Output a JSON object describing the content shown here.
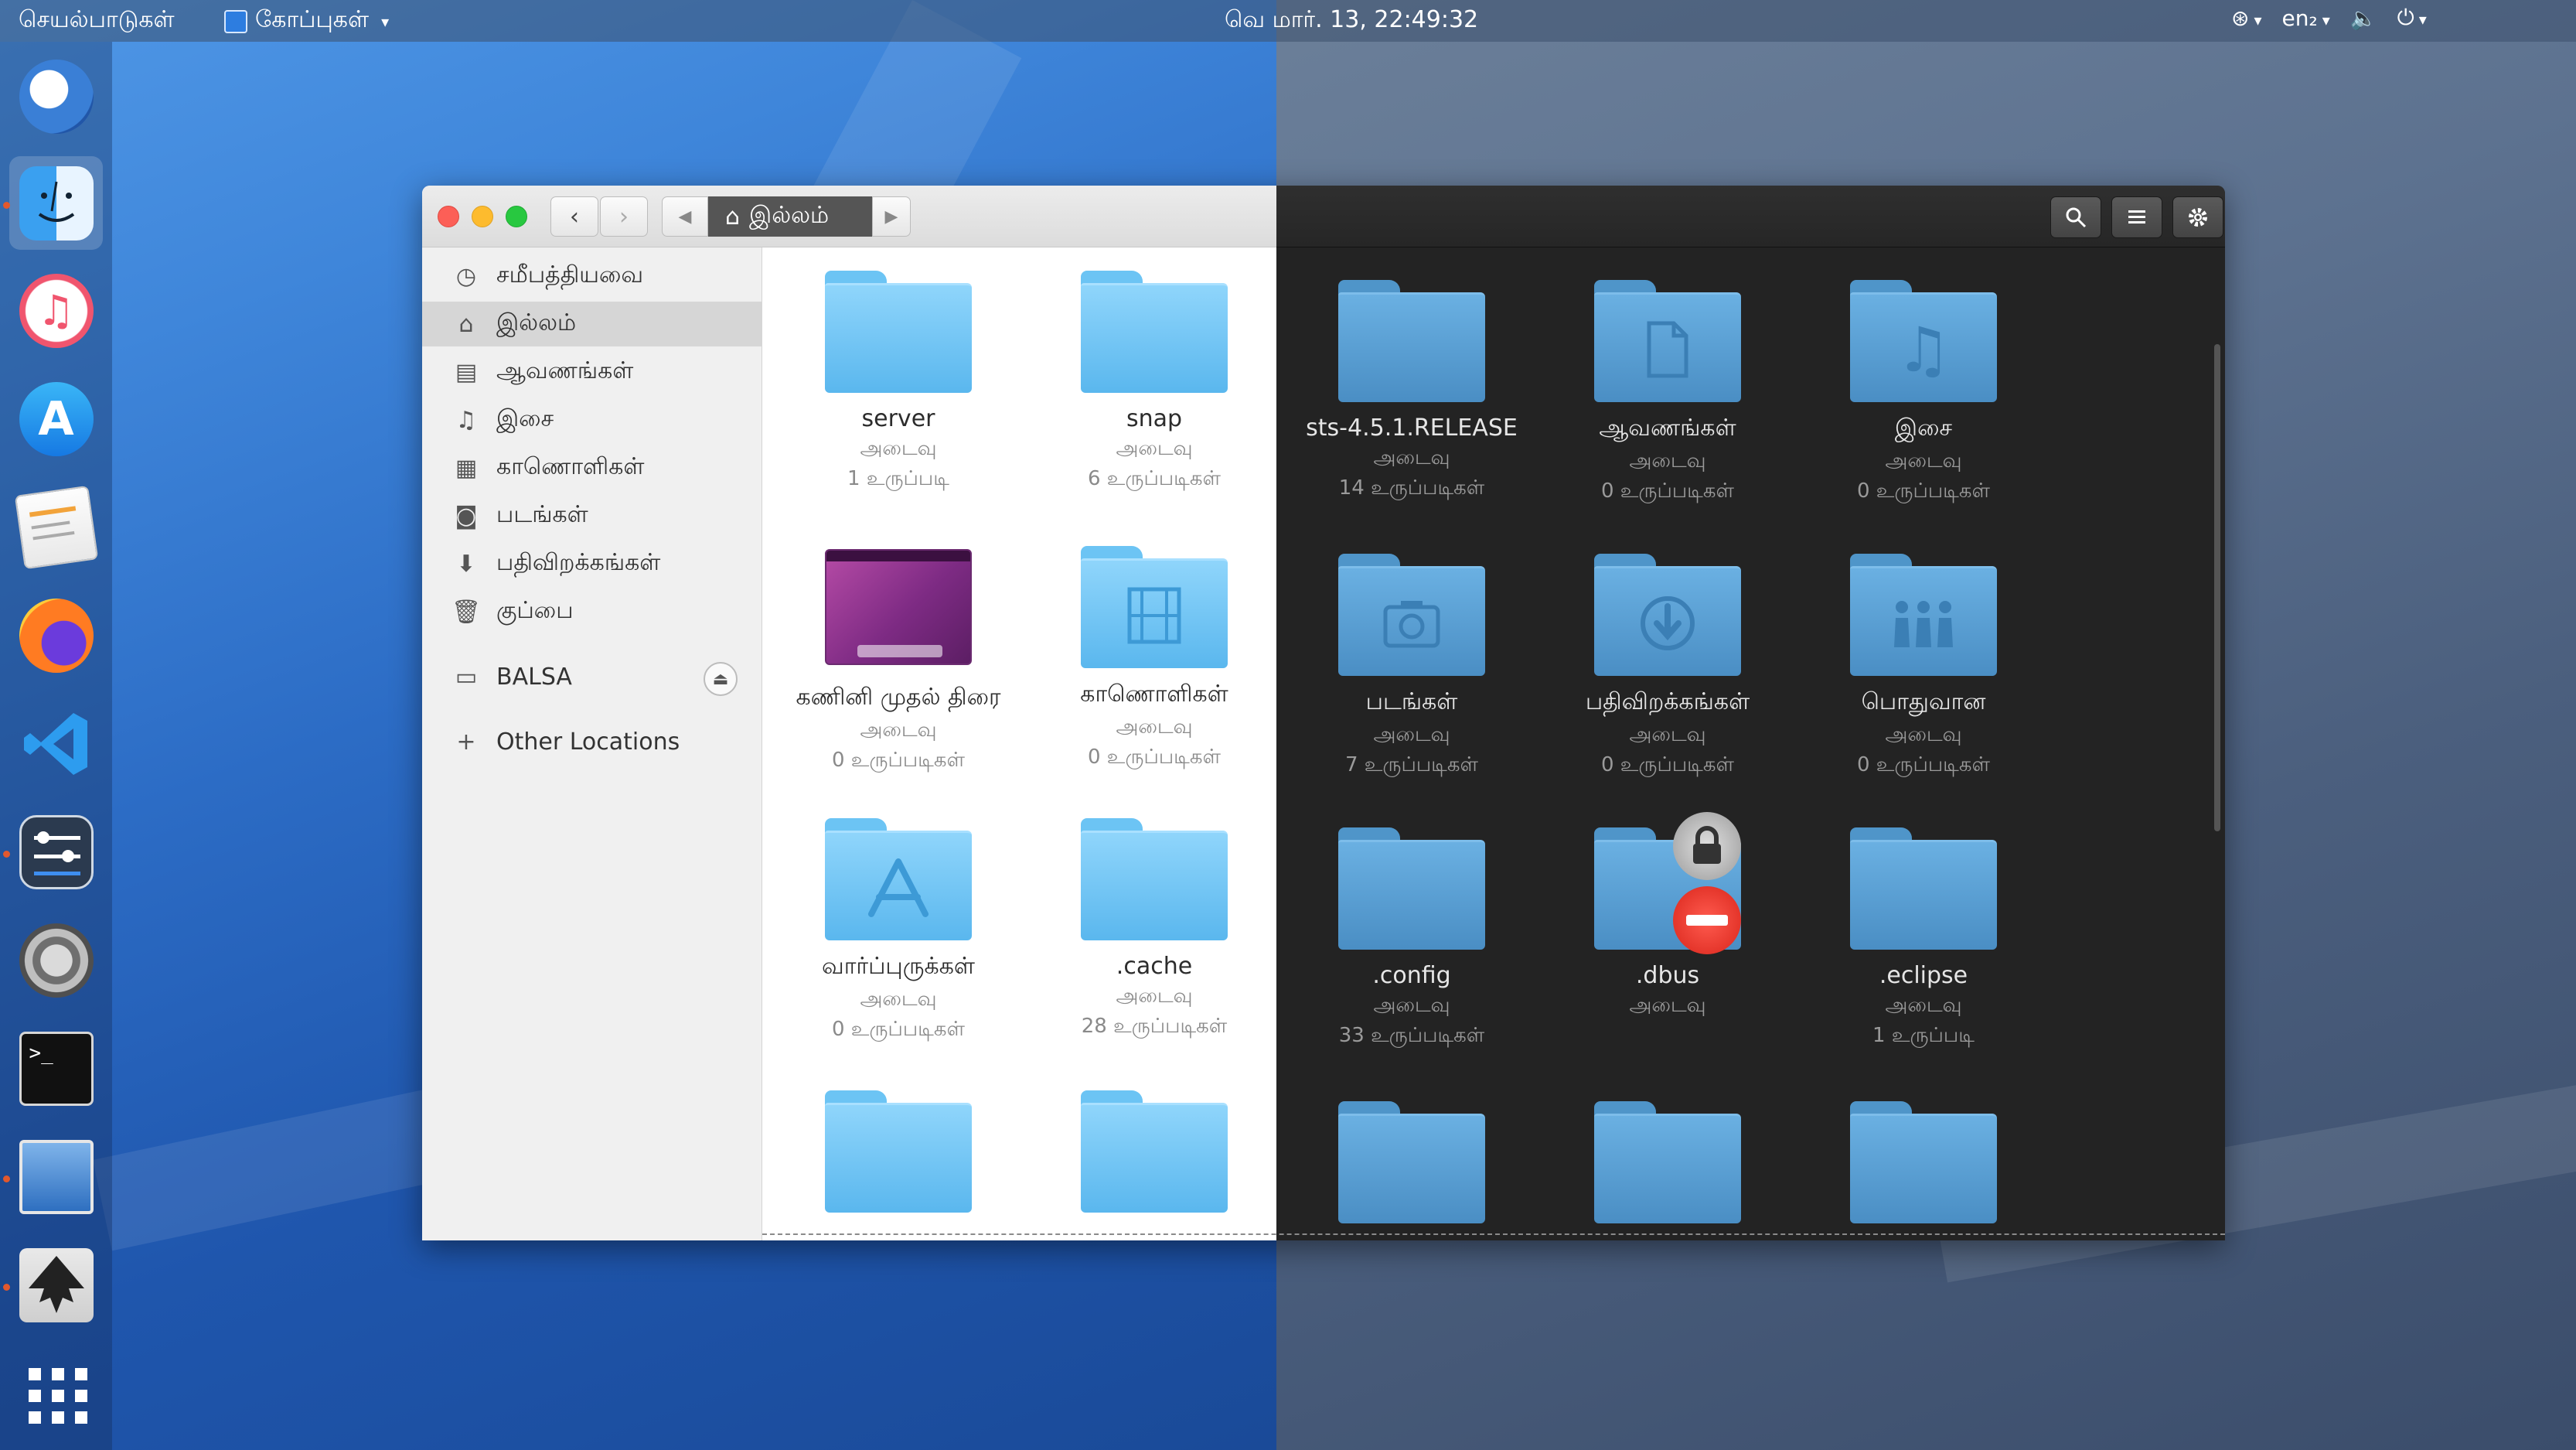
{
  "topbar": {
    "activities": "செயல்பாடுகள்",
    "app_menu": "கோப்புகள்",
    "clock": "வெ மார். 13, 22:49:32",
    "keyboard": "en₂",
    "icons": [
      "accessibility-icon",
      "volume-icon",
      "power-icon"
    ]
  },
  "dock": {
    "apps": [
      "mail-app",
      "finder-app",
      "music-app",
      "app-store",
      "text-editor",
      "firefox",
      "vscode",
      "tweaks",
      "system-settings",
      "terminal",
      "image-viewer",
      "inkscape",
      "show-applications"
    ],
    "colors": {
      "accent": "#2d7de0"
    }
  },
  "window": {
    "path_label": "இல்லம்",
    "toolbar_icons": [
      "back-icon",
      "forward-icon",
      "path-left-icon",
      "home-icon",
      "path-right-icon",
      "search-icon",
      "list-view-icon",
      "gear-icon"
    ]
  },
  "sidebar": {
    "items": [
      {
        "label": "சமீபத்தியவை",
        "icon": "recent-icon"
      },
      {
        "label": "இல்லம்",
        "icon": "home-icon"
      },
      {
        "label": "ஆவணங்கள்",
        "icon": "documents-icon"
      },
      {
        "label": "இசை",
        "icon": "music-icon"
      },
      {
        "label": "காணொளிகள்",
        "icon": "videos-icon"
      },
      {
        "label": "படங்கள்",
        "icon": "pictures-icon"
      },
      {
        "label": "பதிவிறக்கங்கள்",
        "icon": "downloads-icon"
      },
      {
        "label": "குப்பை",
        "icon": "trash-icon"
      }
    ],
    "drive": "BALSA",
    "other_locations": "Other Locations"
  },
  "light_items": [
    {
      "name": "server",
      "type": "அடைவு",
      "count": "1 உருப்படி"
    },
    {
      "name": "snap",
      "type": "அடைவு",
      "count": "6 உருப்படிகள்"
    },
    {
      "name": "கணினி முதல் திரை",
      "type": "அடைவு",
      "count": "0 உருப்படிகள்"
    },
    {
      "name": "காணொளிகள்",
      "type": "அடைவு",
      "count": "0 உருப்படிகள்"
    },
    {
      "name": "வார்ப்புருக்கள்",
      "type": "அடைவு",
      "count": "0 உருப்படிகள்"
    },
    {
      "name": ".cache",
      "type": "அடைவு",
      "count": "28 உருப்படிகள்"
    }
  ],
  "dark_items": [
    {
      "name": "sts-4.5.1.RELEASE",
      "type": "அடைவு",
      "count": "14 உருப்படிகள்"
    },
    {
      "name": "ஆவணங்கள்",
      "type": "அடைவு",
      "count": "0 உருப்படிகள்"
    },
    {
      "name": "இசை",
      "type": "அடைவு",
      "count": "0 உருப்படிகள்"
    },
    {
      "name": "படங்கள்",
      "type": "அடைவு",
      "count": "7 உருப்படிகள்"
    },
    {
      "name": "பதிவிறக்கங்கள்",
      "type": "அடைவு",
      "count": "0 உருப்படிகள்"
    },
    {
      "name": "பொதுவான",
      "type": "அடைவு",
      "count": "0 உருப்படிகள்"
    },
    {
      "name": ".config",
      "type": "அடைவு",
      "count": "33 உருப்படிகள்"
    },
    {
      "name": ".dbus",
      "type": "அடைவு",
      "count": ""
    },
    {
      "name": ".eclipse",
      "type": "அடைவு",
      "count": "1 உருப்படி"
    }
  ]
}
